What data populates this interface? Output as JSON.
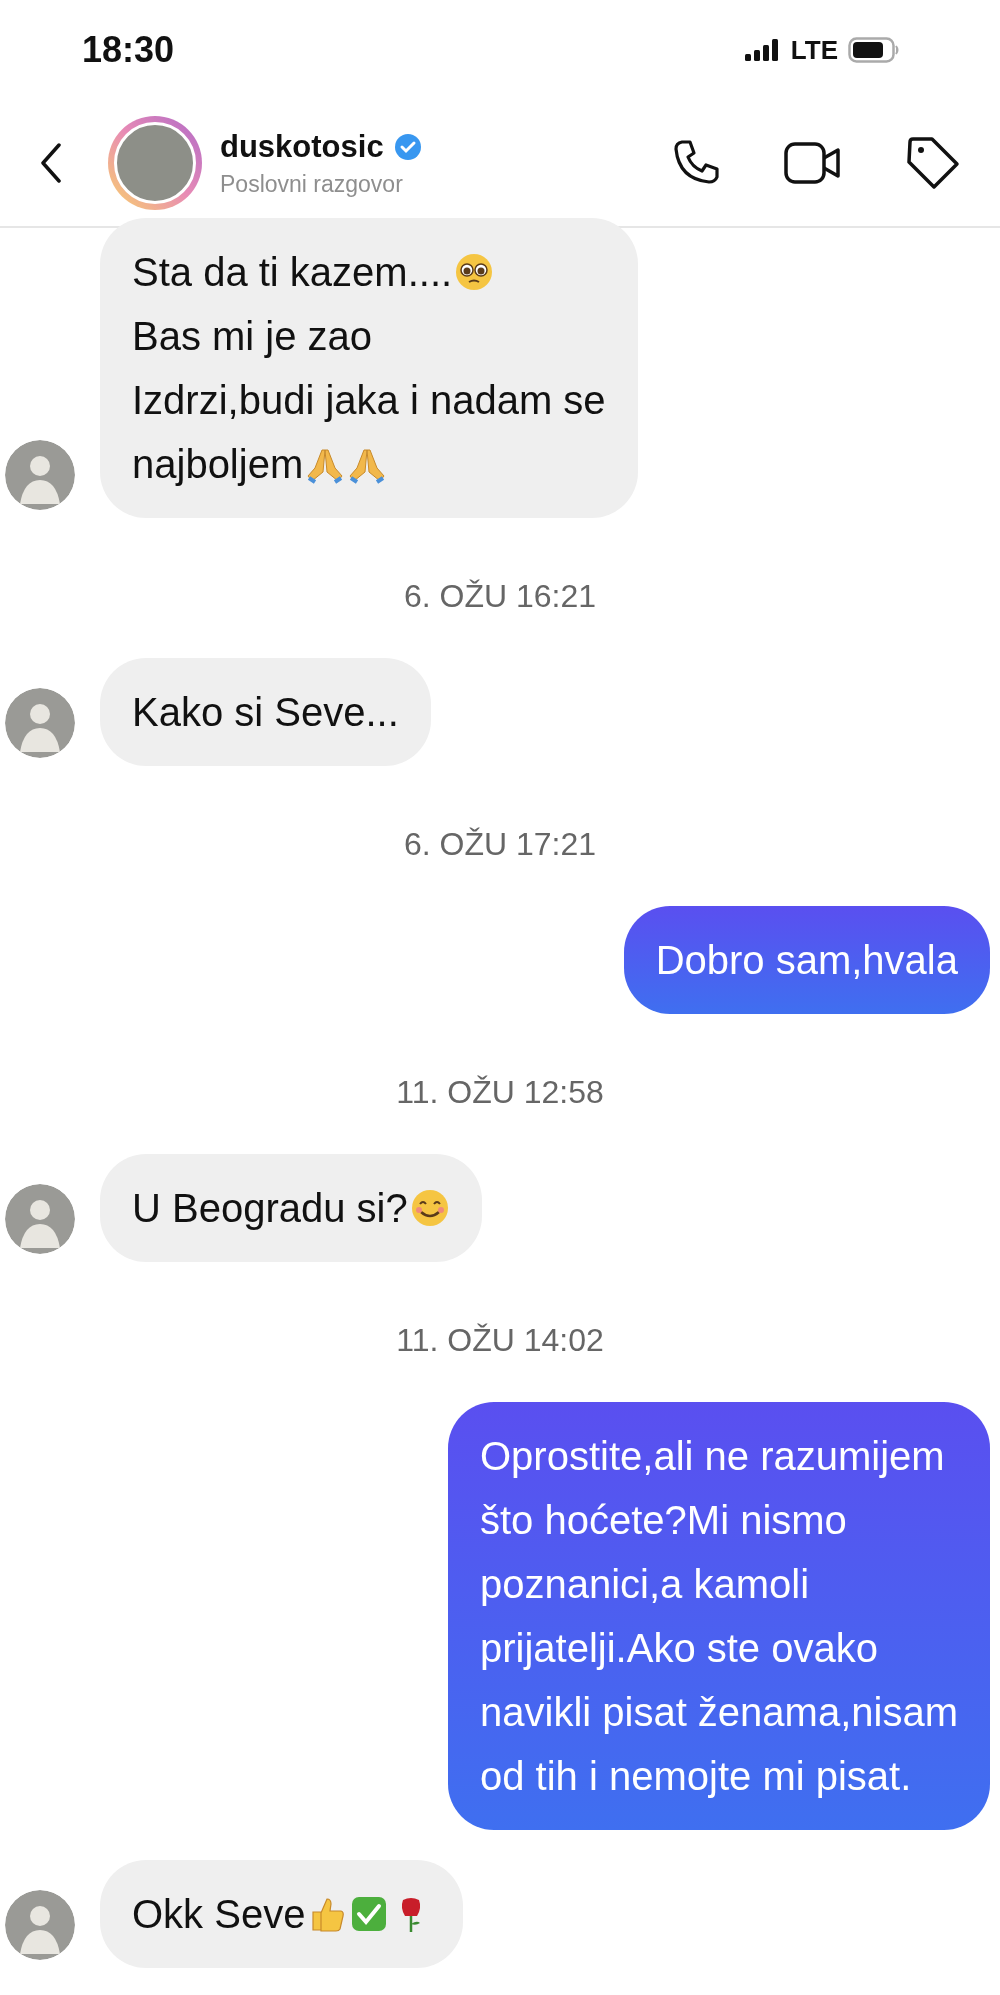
{
  "status_bar": {
    "time": "18:30",
    "network": "LTE"
  },
  "header": {
    "name": "duskotosic",
    "verified": true,
    "subtitle": "Poslovni razgovor"
  },
  "messages": [
    {
      "kind": "received",
      "lines": [
        {
          "text": "Sta da ti kazem....",
          "emojis": [
            {
              "kind": "pleading"
            }
          ]
        },
        {
          "text": "Bas mi je zao"
        },
        {
          "text": "Izdrzi,budi jaka i nadam se"
        },
        {
          "text": "najboljem",
          "emojis": [
            {
              "kind": "pray"
            },
            {
              "kind": "pray"
            }
          ]
        }
      ]
    },
    {
      "kind": "timestamp",
      "text": "6. OŽU 16:21"
    },
    {
      "kind": "received",
      "lines": [
        {
          "text": "Kako si Seve..."
        }
      ]
    },
    {
      "kind": "timestamp",
      "text": "6. OŽU 17:21"
    },
    {
      "kind": "sent",
      "lines": [
        {
          "text": "Dobro sam,hvala"
        }
      ]
    },
    {
      "kind": "timestamp",
      "text": "11. OŽU 12:58"
    },
    {
      "kind": "received",
      "lines": [
        {
          "text": "U Beogradu si?",
          "emojis": [
            {
              "kind": "smile"
            }
          ]
        }
      ]
    },
    {
      "kind": "timestamp",
      "text": "11. OŽU 14:02"
    },
    {
      "kind": "sent",
      "lines": [
        {
          "text": "Oprostite,ali ne razumijem"
        },
        {
          "text": "što hoćete?Mi nismo"
        },
        {
          "text": "poznanici,a kamoli"
        },
        {
          "text": "prijatelji.Ako ste ovako"
        },
        {
          "text": "navikli pisat ženama,nisam"
        },
        {
          "text": "od tih i nemojte mi pisat."
        }
      ]
    },
    {
      "kind": "received",
      "lines": [
        {
          "text": "Okk Seve",
          "emojis": [
            {
              "kind": "thumbs-up"
            },
            {
              "kind": "check"
            },
            {
              "kind": "rose"
            }
          ]
        }
      ]
    }
  ]
}
